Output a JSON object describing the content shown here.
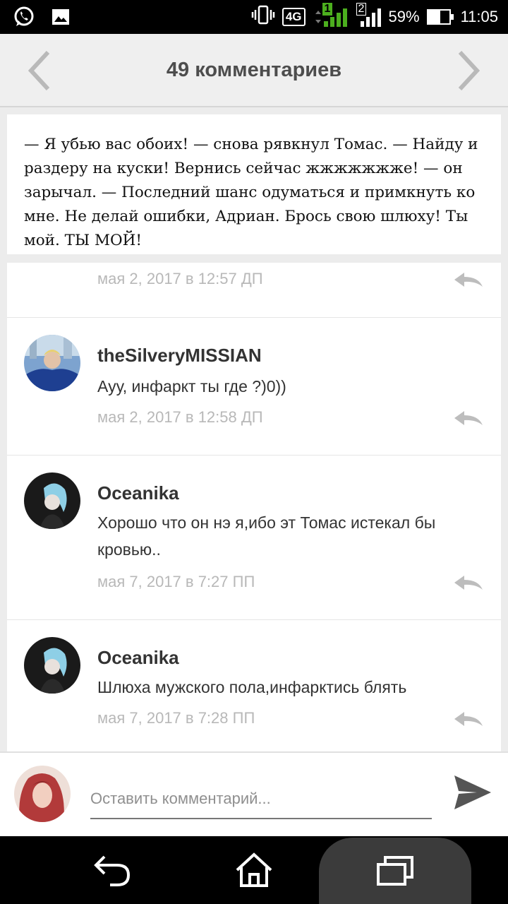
{
  "status_bar": {
    "network": "4G",
    "sim1": "1",
    "sim2": "2",
    "battery": "59%",
    "battery_level": 0.59,
    "time": "11:05",
    "left_icons": [
      "whatsapp-icon",
      "gallery-icon"
    ],
    "right_icons": [
      "vibrate-icon",
      "signal-icon",
      "battery-icon"
    ]
  },
  "header": {
    "title": "49 комментариев",
    "prev_icon": "chevron-left-icon",
    "next_icon": "chevron-right-icon"
  },
  "excerpt": {
    "text": "— Я убью вас обоих! — снова рявкнул Томас. — Найду и раздеру на куски! Вернись сейчас жжжжжжже! — он зарычал. — Последний шанс одуматься и примкнуть ко мне. Не делай ошибки, Адриан. Брось свою шлюху! Ты мой. ТЫ МОЙ!"
  },
  "comments": [
    {
      "date": "мая 2, 2017 в 12:57 ДП"
    },
    {
      "author": "theSilveryMISSIAN",
      "text": "Ауу, инфаркт ты где ?)0))",
      "date": "мая 2, 2017 в 12:58 ДП"
    },
    {
      "author": "Oceanika",
      "text": "Хорошо что он нэ я,ибо эт Томас истекал бы кровью..",
      "date": "мая 7, 2017 в 7:27 ПП"
    },
    {
      "author": "Oceanika",
      "text": "Шлюха мужского пола,инфарктись блять",
      "date": "мая 7, 2017 в 7:28 ПП"
    }
  ],
  "composer": {
    "placeholder": "Оставить комментарий...",
    "value": "",
    "send_icon": "send-icon"
  },
  "navbar": {
    "icons": [
      "back-icon",
      "home-icon",
      "recent-apps-icon"
    ]
  },
  "colors": {
    "header_bg": "#efefef",
    "date": "#b8b8b8",
    "text": "#333333",
    "navbar_bg": "#000000"
  }
}
